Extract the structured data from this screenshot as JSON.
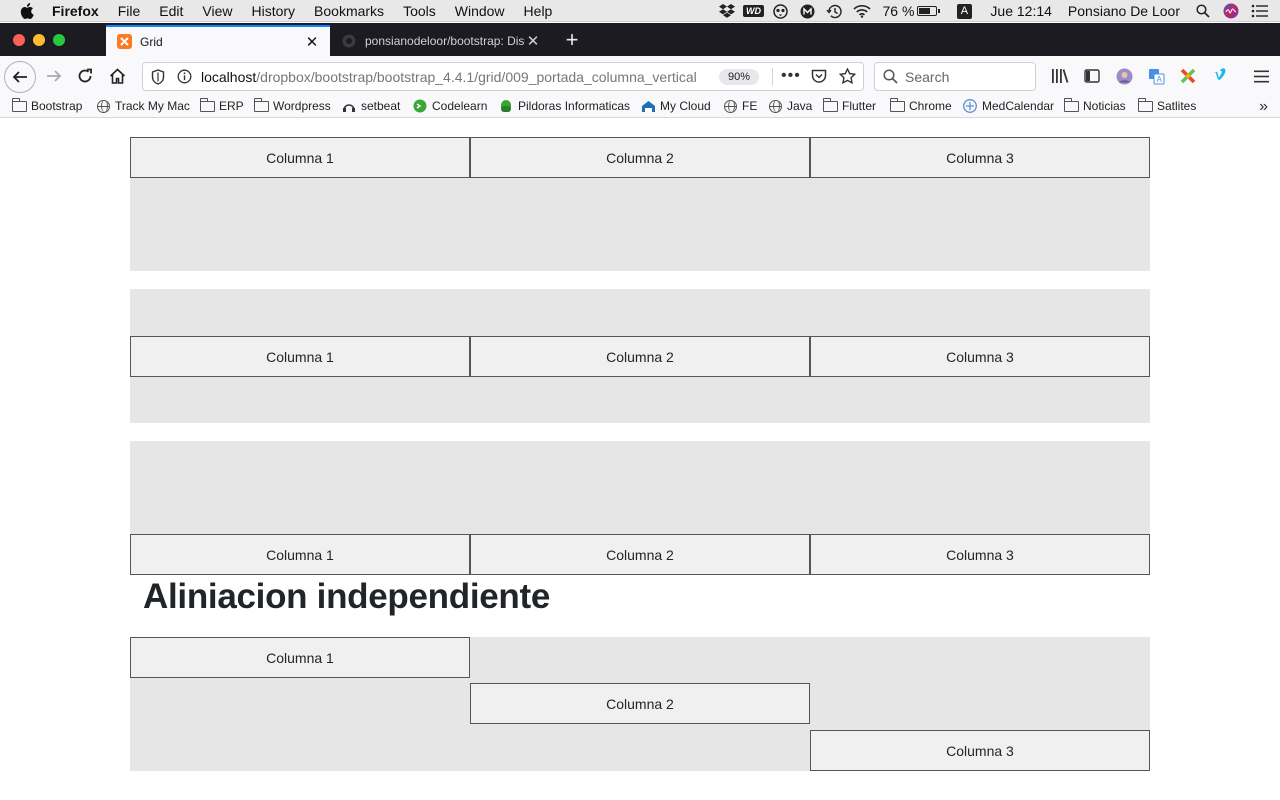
{
  "menubar": {
    "app_name": "Firefox",
    "items": [
      "File",
      "Edit",
      "View",
      "History",
      "Bookmarks",
      "Tools",
      "Window",
      "Help"
    ],
    "status_icons": [
      "dropbox-icon",
      "wd-icon",
      "owl-icon",
      "m-icon",
      "time-machine-icon",
      "wifi-icon"
    ],
    "wd_badge": "WD",
    "battery": "76 %",
    "battery_level": 0.76,
    "input_source": "A",
    "clock": "Jue 12:14",
    "user": "Ponsiano De Loor"
  },
  "tabs": [
    {
      "title": "Grid",
      "icon": "xampp-icon",
      "active": true
    },
    {
      "title": "ponsianodeloor/bootstrap: Dise",
      "icon": "github-icon",
      "active": false
    }
  ],
  "toolbar": {
    "url_host": "localhost",
    "url_path": "/dropbox/bootstrap/bootstrap_4.4.1/grid/009_portada_columna_vertical",
    "zoom": "90%",
    "search_placeholder": "Search"
  },
  "bookmarks": [
    {
      "label": "Bootstrap",
      "icon": "folder-icon"
    },
    {
      "label": "Track My Mac",
      "icon": "globe-icon"
    },
    {
      "label": "ERP",
      "icon": "folder-icon"
    },
    {
      "label": "Wordpress",
      "icon": "folder-icon"
    },
    {
      "label": "setbeat",
      "icon": "setbeat-icon"
    },
    {
      "label": "Codelearn",
      "icon": "codelearn-icon"
    },
    {
      "label": "Pildoras Informaticas",
      "icon": "pildoras-icon"
    },
    {
      "label": "My Cloud",
      "icon": "cloud-icon"
    },
    {
      "label": "FE",
      "icon": "globe-icon"
    },
    {
      "label": "Java",
      "icon": "globe-icon"
    },
    {
      "label": "Flutter",
      "icon": "folder-icon"
    },
    {
      "label": "Chrome",
      "icon": "folder-icon"
    },
    {
      "label": "MedCalendar",
      "icon": "medcalendar-icon"
    },
    {
      "label": "Noticias",
      "icon": "folder-icon"
    },
    {
      "label": "Satlites",
      "icon": "folder-icon"
    }
  ],
  "page": {
    "rows": [
      {
        "alignment": "start",
        "columns": [
          "Columna 1",
          "Columna 2",
          "Columna 3"
        ]
      },
      {
        "alignment": "center",
        "columns": [
          "Columna 1",
          "Columna 2",
          "Columna 3"
        ]
      },
      {
        "alignment": "end",
        "columns": [
          "Columna 1",
          "Columna 2",
          "Columna 3"
        ]
      }
    ],
    "heading": "Aliniacion independiente",
    "independent_row": {
      "columns": [
        "Columna 1",
        "Columna 2",
        "Columna 3"
      ],
      "alignments": [
        "start",
        "center",
        "end"
      ]
    }
  },
  "colors": {
    "tab_strip": "#1c1b22",
    "accent": "#0a84ff",
    "row_background": "#e6e6e6",
    "column_background": "#f0f0f0",
    "column_border": "#555555"
  }
}
